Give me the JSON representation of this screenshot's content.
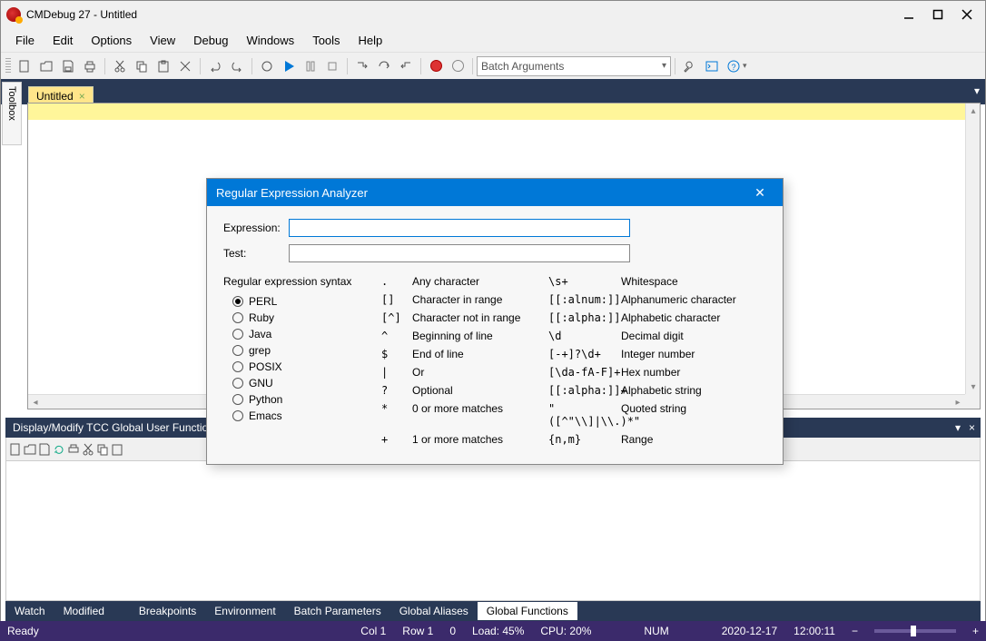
{
  "title": "CMDebug 27 - Untitled",
  "menu": [
    "File",
    "Edit",
    "Options",
    "View",
    "Debug",
    "Windows",
    "Tools",
    "Help"
  ],
  "batch_placeholder": "Batch Arguments",
  "toolbox_label": "Toolbox",
  "filetab": "Untitled",
  "bottom_panel_title": "Display/Modify TCC Global User Functions",
  "bottom_tabs": [
    "Watch",
    "Modified",
    "Breakpoints",
    "Environment",
    "Batch Parameters",
    "Global Aliases",
    "Global Functions"
  ],
  "bottom_active_tab": 6,
  "status": {
    "ready": "Ready",
    "col": "Col 1",
    "row": "Row 1",
    "zero": "0",
    "load": "Load: 45%",
    "cpu": "CPU: 20%",
    "num": "NUM",
    "date": "2020-12-17",
    "time": "12:00:11"
  },
  "dialog": {
    "title": "Regular Expression Analyzer",
    "expression_label": "Expression:",
    "test_label": "Test:",
    "expression_value": "",
    "test_value": "",
    "syntax_label": "Regular expression syntax",
    "syntax_options": [
      "PERL",
      "Ruby",
      "Java",
      "grep",
      "POSIX",
      "GNU",
      "Python",
      "Emacs"
    ],
    "syntax_selected": 0,
    "ref": [
      {
        "sym": ".",
        "desc": "Any character",
        "sym2": "\\s+",
        "desc2": "Whitespace"
      },
      {
        "sym": "[]",
        "desc": "Character in range",
        "sym2": "[[:alnum:]]",
        "desc2": "Alphanumeric character"
      },
      {
        "sym": "[^]",
        "desc": "Character not in range",
        "sym2": "[[:alpha:]]",
        "desc2": "Alphabetic character"
      },
      {
        "sym": "^",
        "desc": "Beginning of line",
        "sym2": "\\d",
        "desc2": "Decimal digit"
      },
      {
        "sym": "$",
        "desc": "End of line",
        "sym2": "[-+]?\\d+",
        "desc2": "Integer number"
      },
      {
        "sym": "|",
        "desc": "Or",
        "sym2": "[\\da-fA-F]+",
        "desc2": "Hex number"
      },
      {
        "sym": "?",
        "desc": "Optional",
        "sym2": "[[:alpha:]]+",
        "desc2": "Alphabetic string"
      },
      {
        "sym": "*",
        "desc": "0 or more matches",
        "sym2": "\"([^\"\\\\]|\\\\.)*\"",
        "desc2": "Quoted string"
      },
      {
        "sym": "+",
        "desc": "1 or more matches",
        "sym2": "{n,m}",
        "desc2": "Range"
      }
    ]
  }
}
